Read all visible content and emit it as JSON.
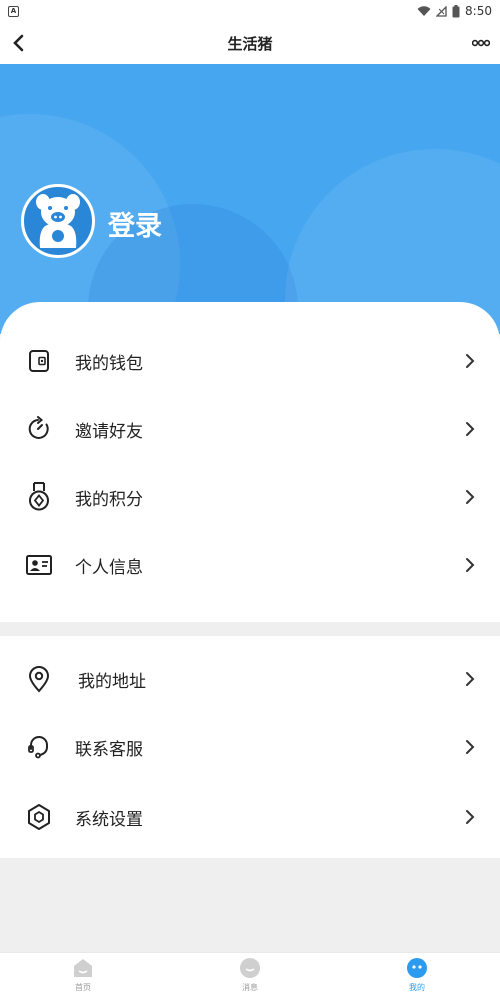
{
  "status_bar": {
    "time": "8:50"
  },
  "header": {
    "title": "生活猪"
  },
  "profile": {
    "login_label": "登录"
  },
  "menu_group_1": [
    {
      "label": "我的钱包",
      "icon": "wallet-icon"
    },
    {
      "label": "邀请好友",
      "icon": "refresh-icon"
    },
    {
      "label": "我的积分",
      "icon": "medal-icon"
    },
    {
      "label": "个人信息",
      "icon": "id-card-icon"
    }
  ],
  "menu_group_2": [
    {
      "label": "我的地址",
      "icon": "location-pin-icon"
    },
    {
      "label": "联系客服",
      "icon": "headset-icon"
    },
    {
      "label": "系统设置",
      "icon": "settings-hexagon-icon"
    }
  ],
  "tab_bar": {
    "tabs": [
      {
        "label": "首页",
        "icon": "home-icon"
      },
      {
        "label": "消息",
        "icon": "message-icon"
      },
      {
        "label": "我的",
        "icon": "me-face-icon",
        "active": true
      }
    ]
  },
  "colors": {
    "accent": "#46a6ef",
    "active_tab": "#2c9aee",
    "background": "#efefef"
  }
}
